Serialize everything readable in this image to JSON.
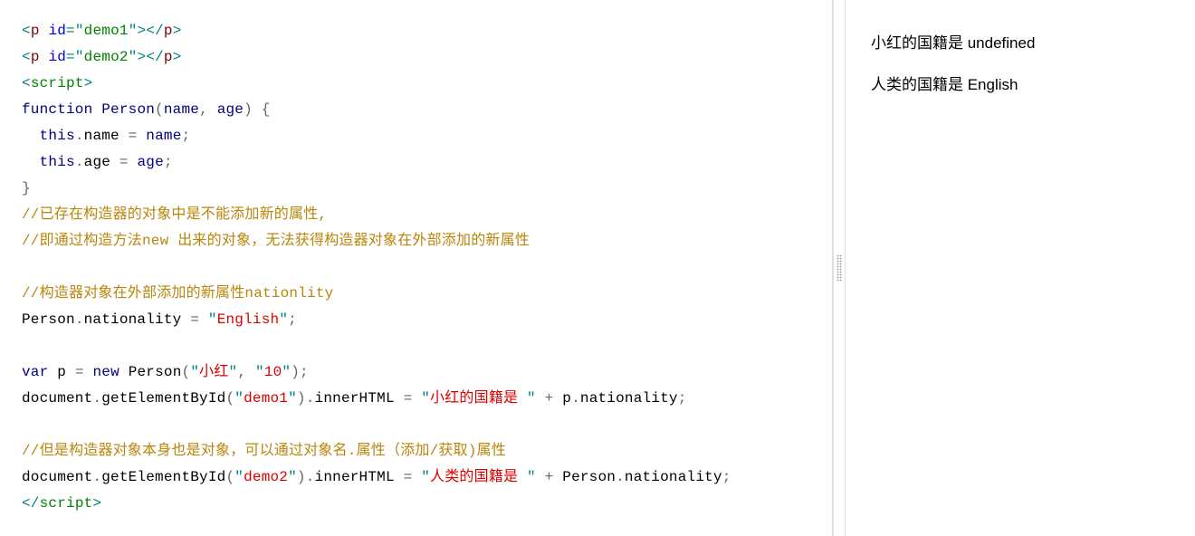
{
  "code": {
    "line1": {
      "open_bracket": "<",
      "tag_p": "p",
      "space": " ",
      "attr_id": "id",
      "equals": "=",
      "quote_open": "\"",
      "id_value": "demo1",
      "quote_close": "\"",
      "close_bracket": ">",
      "open_bracket2": "</",
      "tag_p2": "p",
      "close_bracket2": ">"
    },
    "line2": {
      "open_bracket": "<",
      "tag_p": "p",
      "space": " ",
      "attr_id": "id",
      "equals": "=",
      "quote_open": "\"",
      "id_value": "demo2",
      "quote_close": "\"",
      "close_bracket": ">",
      "open_bracket2": "</",
      "tag_p2": "p",
      "close_bracket2": ">"
    },
    "line3": {
      "open_bracket": "<",
      "tag": "script",
      "close_bracket": ">"
    },
    "line4": {
      "kw_function": "function",
      "space1": " ",
      "name": "Person",
      "paren_open": "(",
      "param1": "name",
      "comma": ",",
      "space2": " ",
      "param2": "age",
      "paren_close": ")",
      "space3": " ",
      "brace_open": "{"
    },
    "line5": {
      "indent": "  ",
      "this": "this",
      "dot": ".",
      "prop": "name",
      "space1": " ",
      "equals": "=",
      "space2": " ",
      "val": "name",
      "semi": ";"
    },
    "line6": {
      "indent": "  ",
      "this": "this",
      "dot": ".",
      "prop": "age",
      "space1": " ",
      "equals": "=",
      "space2": " ",
      "val": "age",
      "semi": ";"
    },
    "line7": {
      "brace_close": "}"
    },
    "line8": {
      "comment": "//已存在构造器的对象中是不能添加新的属性,"
    },
    "line9": {
      "comment": "//即通过构造方法new 出来的对象，无法获得构造器对象在外部添加的新属性"
    },
    "line10": {
      "blank": " "
    },
    "line11": {
      "comment": "//构造器对象在外部添加的新属性nationlity"
    },
    "line12": {
      "obj": "Person",
      "dot": ".",
      "prop": "nationality",
      "space1": " ",
      "equals": "=",
      "space2": " ",
      "quote1": "\"",
      "str": "English",
      "quote2": "\"",
      "semi": ";"
    },
    "line13": {
      "blank": " "
    },
    "line14": {
      "kw_var": "var",
      "space1": " ",
      "varname": "p",
      "space2": " ",
      "equals": "=",
      "space3": " ",
      "kw_new": "new",
      "space4": " ",
      "ctor": "Person",
      "paren_open": "(",
      "quote1": "\"",
      "str1": "小红",
      "quote2": "\"",
      "comma": ",",
      "space5": " ",
      "quote3": "\"",
      "str2": "10",
      "quote4": "\"",
      "paren_close": ")",
      "semi": ";"
    },
    "line15": {
      "doc": "document",
      "dot1": ".",
      "method": "getElementById",
      "paren_open": "(",
      "quote1": "\"",
      "str1": "demo1",
      "quote2": "\"",
      "paren_close": ")",
      "dot2": ".",
      "prop": "innerHTML",
      "space1": " ",
      "equals": "=",
      "space2": " ",
      "quote3": "\"",
      "str2": "小红的国籍是 ",
      "quote4": "\"",
      "space3": " ",
      "plus": "+",
      "space4": " ",
      "obj": "p",
      "dot3": ".",
      "prop2": "nationality",
      "semi": ";"
    },
    "line16": {
      "blank": " "
    },
    "line17": {
      "comment": "//但是构造器对象本身也是对象，可以通过对象名.属性（添加/获取)属性"
    },
    "line18": {
      "doc": "document",
      "dot1": ".",
      "method": "getElementById",
      "paren_open": "(",
      "quote1": "\"",
      "str1": "demo2",
      "quote2": "\"",
      "paren_close": ")",
      "dot2": ".",
      "prop": "innerHTML",
      "space1": " ",
      "equals": "=",
      "space2": " ",
      "quote3": "\"",
      "str2": "人类的国籍是 ",
      "quote4": "\"",
      "space3": " ",
      "plus": "+",
      "space4": " ",
      "obj": "Person",
      "dot3": ".",
      "prop2": "nationality",
      "semi": ";"
    },
    "line19": {
      "open_bracket": "</",
      "tag": "script",
      "close_bracket": ">"
    }
  },
  "output": {
    "line1": "小红的国籍是 undefined",
    "line2": "人类的国籍是 English"
  }
}
